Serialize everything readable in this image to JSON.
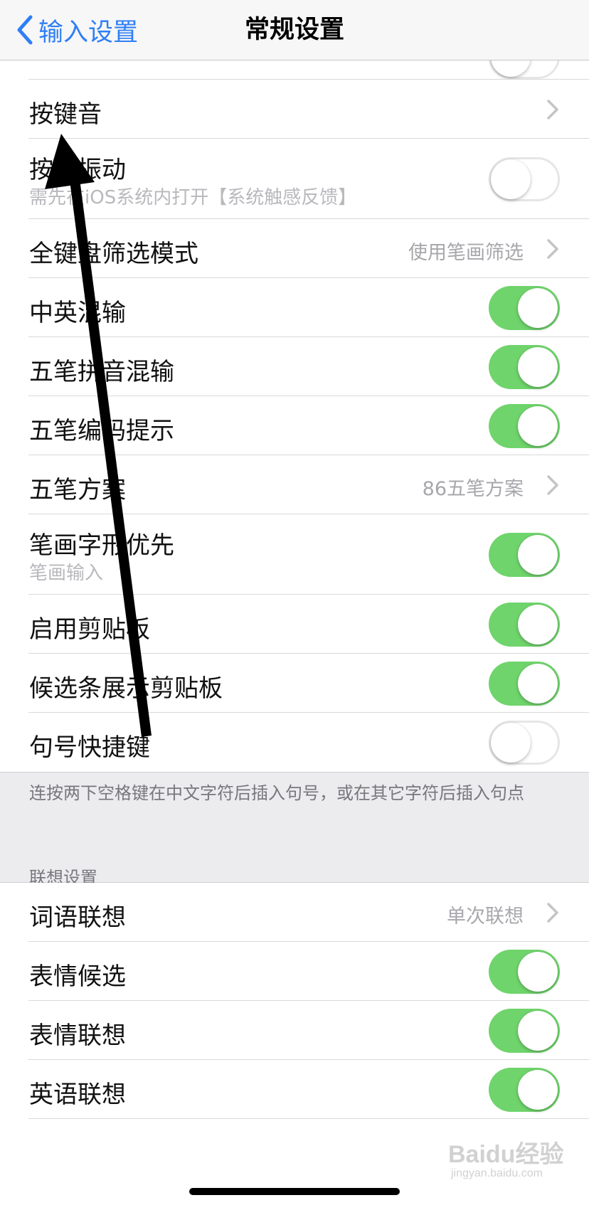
{
  "nav": {
    "back_label": "输入设置",
    "title": "常规设置"
  },
  "rows": [
    {
      "label": "按键音",
      "type": "link"
    },
    {
      "label": "按键振动",
      "sublabel": "需先在iOS系统内打开【系统触感反馈】",
      "type": "toggle",
      "on": false
    },
    {
      "label": "全键盘筛选模式",
      "value": "使用笔画筛选",
      "type": "link"
    },
    {
      "label": "中英混输",
      "type": "toggle",
      "on": true
    },
    {
      "label": "五笔拼音混输",
      "type": "toggle",
      "on": true
    },
    {
      "label": "五笔编码提示",
      "type": "toggle",
      "on": true
    },
    {
      "label": "五笔方案",
      "value": "86五笔方案",
      "type": "link"
    },
    {
      "label": "笔画字形优先",
      "sublabel": "笔画输入",
      "type": "toggle",
      "on": true
    },
    {
      "label": "启用剪贴板",
      "type": "toggle",
      "on": true
    },
    {
      "label": "候选条展示剪贴板",
      "type": "toggle",
      "on": true
    },
    {
      "label": "句号快捷键",
      "type": "toggle",
      "on": false
    }
  ],
  "footer_note": "连按两下空格键在中文字符后插入句号，或在其它字符后插入句点",
  "section2_header": "联想设置",
  "rows2": [
    {
      "label": "词语联想",
      "value": "单次联想",
      "type": "link"
    },
    {
      "label": "表情候选",
      "type": "toggle",
      "on": true
    },
    {
      "label": "表情联想",
      "type": "toggle",
      "on": true
    },
    {
      "label": "英语联想",
      "type": "toggle",
      "on": true
    }
  ],
  "watermark": {
    "main": "Baidu经验",
    "sub": "jingyan.baidu.com"
  },
  "colors": {
    "accent": "#2f7ff5",
    "toggle_on": "#6fd46b",
    "arrow": "#000000"
  }
}
